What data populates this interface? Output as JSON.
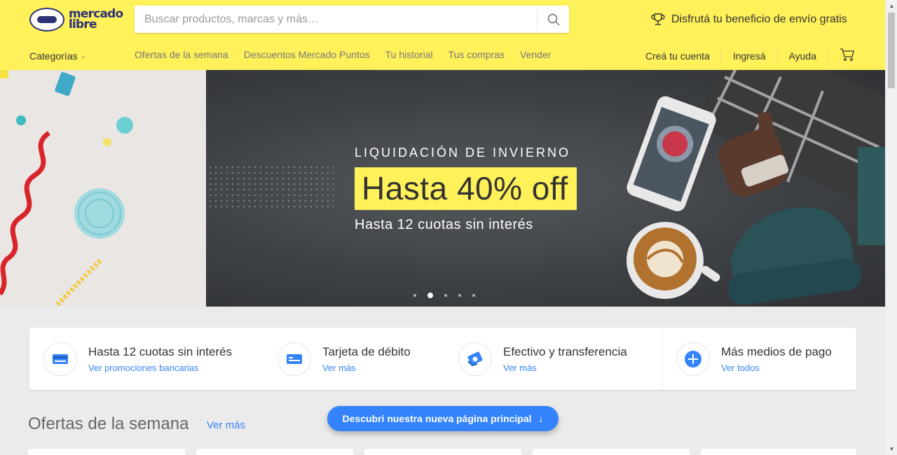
{
  "header": {
    "logo_line1": "mercado",
    "logo_line2": "libre",
    "search_placeholder": "Buscar productos, marcas y más…",
    "promo": "Disfrutá tu beneficio de envío gratis",
    "categories_label": "Categorías",
    "nav_links": [
      "Ofertas de la semana",
      "Descuentos Mercado Puntos",
      "Tu historial",
      "Tus compras",
      "Vender"
    ],
    "account_links": [
      "Creá tu cuenta",
      "Ingresá",
      "Ayuda"
    ],
    "brand_color": "#fff159"
  },
  "hero": {
    "kicker": "LIQUIDACIÓN DE INVIERNO",
    "headline": "Hasta 40% off",
    "subline": "Hasta 12 cuotas sin interés",
    "active_slide": 2,
    "total_slides": 5
  },
  "payments": [
    {
      "title": "Hasta 12 cuotas sin interés",
      "link": "Ver promociones bancarias",
      "icon": "credit-card-icon"
    },
    {
      "title": "Tarjeta de débito",
      "link": "Ver más",
      "icon": "debit-card-icon"
    },
    {
      "title": "Efectivo y transferencia",
      "link": "Ver más",
      "icon": "cash-icon"
    },
    {
      "title": "Más medios de pago",
      "link": "Ver todos",
      "icon": "plus-icon"
    }
  ],
  "offers": {
    "title": "Ofertas de la semana",
    "more_link": "Ver más"
  },
  "cta": {
    "label": "Descubrí nuestra nueva página principal"
  },
  "colors": {
    "accent_blue": "#3483fa",
    "header_yellow": "#fff159"
  }
}
